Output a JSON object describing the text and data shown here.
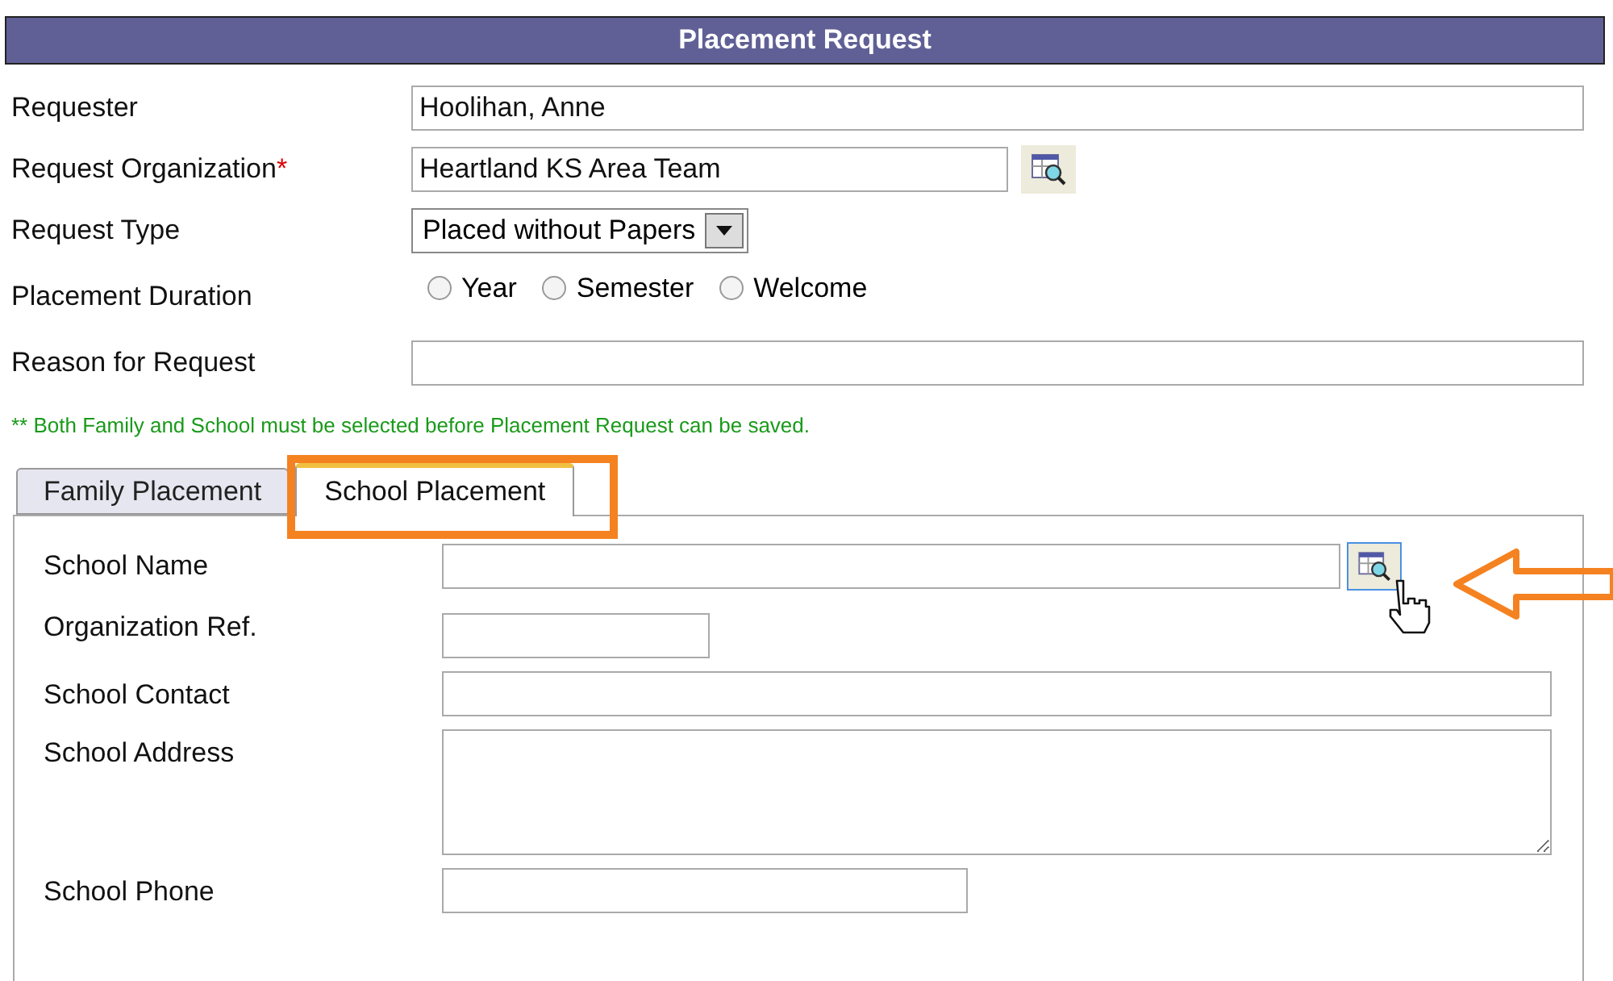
{
  "header": {
    "title": "Placement Request"
  },
  "fields": [
    {
      "kind": "text",
      "label": "Requester",
      "value": "Hoolihan, Anne"
    },
    {
      "kind": "lookup",
      "label": "Request Organization",
      "required_mark": "*",
      "value": "Heartland KS Area Team"
    },
    {
      "kind": "select",
      "label": "Request Type",
      "value": "Placed without Papers"
    },
    {
      "kind": "radio",
      "label": "Placement Duration",
      "options": [
        {
          "label": "Year",
          "selected": false
        },
        {
          "label": "Semester",
          "selected": false
        },
        {
          "label": "Welcome",
          "selected": false
        }
      ]
    },
    {
      "kind": "text",
      "label": "Reason for Request"
    }
  ],
  "note": "** Both Family and School must be selected before Placement Request can be saved.",
  "tabs": [
    {
      "label": "Family Placement",
      "selected": false
    },
    {
      "label": "School Placement",
      "selected": true
    }
  ],
  "school_fields": [
    {
      "kind": "lookup",
      "label": "School Name"
    },
    {
      "kind": "short",
      "label": "Organization Ref."
    },
    {
      "kind": "text",
      "label": "School Contact"
    },
    {
      "kind": "textarea",
      "label": "School Address"
    },
    {
      "kind": "phone",
      "label": "School Phone"
    }
  ]
}
